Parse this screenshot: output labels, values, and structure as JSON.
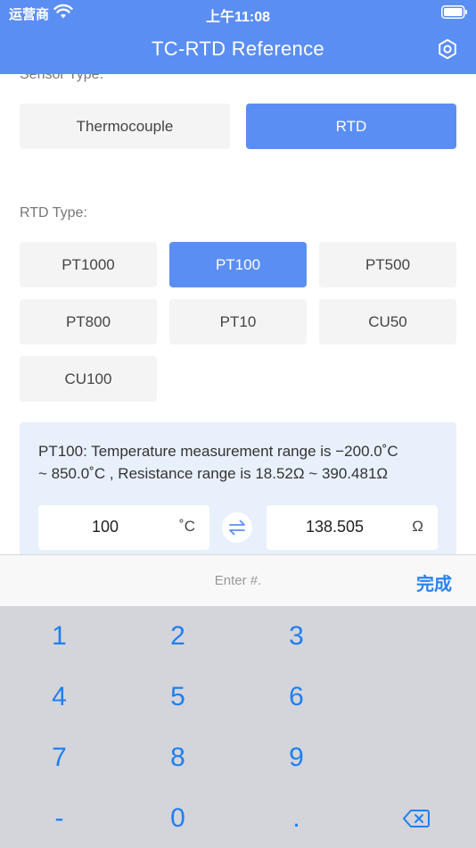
{
  "status_bar": {
    "carrier": "运营商",
    "time": "上午11:08"
  },
  "header": {
    "title": "TC-RTD Reference"
  },
  "sensor": {
    "label": "Sensor Type:",
    "options": [
      "Thermocouple",
      "RTD"
    ],
    "selected": "RTD"
  },
  "rtd": {
    "label": "RTD Type:",
    "options": [
      "PT1000",
      "PT100",
      "PT500",
      "PT800",
      "PT10",
      "CU50",
      "CU100"
    ],
    "selected": "PT100"
  },
  "info": {
    "line1": "PT100: Temperature measurement range is −200.0˚C",
    "line2": "~ 850.0˚C , Resistance range is 18.52Ω ~ 390.481Ω"
  },
  "temperature": {
    "value": "100",
    "unit": "˚C"
  },
  "resistance": {
    "value": "138.505",
    "unit": "Ω"
  },
  "keyboard": {
    "placeholder": "Enter #.",
    "done_label": "完成",
    "keys": [
      "1",
      "2",
      "3",
      "4",
      "5",
      "6",
      "7",
      "8",
      "9",
      "-",
      "0",
      "."
    ]
  },
  "colors": {
    "accent": "#5b8ef2",
    "key_text": "#1f7ff0",
    "keypad_bg": "#d3d5db"
  }
}
